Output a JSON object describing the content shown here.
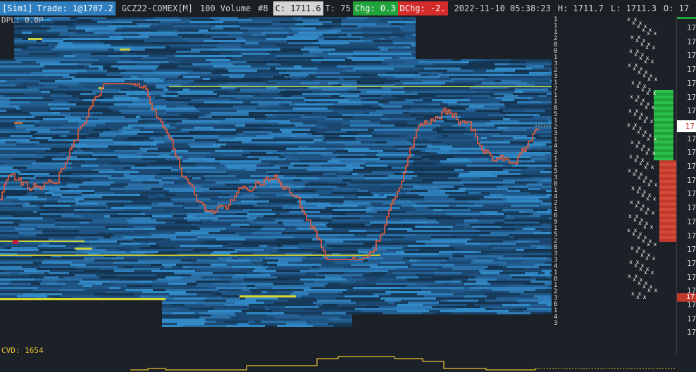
{
  "header": {
    "sim": "[Sim1]",
    "trade": "Trade: 1@1707.2",
    "instrument": "GCZ22-COMEX[M]",
    "volume": "100 Volume",
    "ticks_hash": "#8",
    "close": "C: 1711.6",
    "trades": "T: 75",
    "chg": "Chg: 0.3",
    "dchg": "DChg: -2.",
    "datetime": "2022-11-10 05:38:23",
    "high": "H: 1711.7",
    "low": "L: 1711.3",
    "open": "O: 17"
  },
  "dpl": "DPL: 0.0P",
  "cvd": "CVD: 1654",
  "axis": {
    "labels": [
      "17",
      "17",
      "17",
      "17",
      "17",
      "17",
      "17",
      "17",
      "17",
      "17",
      "17",
      "17",
      "17",
      "17",
      "17",
      "17",
      "17",
      "17",
      "17",
      "17",
      "17",
      "17",
      "17"
    ],
    "current_price": "17",
    "low_marker": "17"
  },
  "vol_strip": [
    "1",
    "1",
    "1",
    "2",
    "8",
    "0",
    "1",
    "3",
    "2",
    "3",
    "1",
    "7",
    "1",
    "1",
    "8",
    "5",
    "1",
    "2",
    "3",
    "1",
    "4",
    "3",
    "1",
    "1",
    "5",
    "3",
    "8",
    "1",
    "4",
    "2",
    "1",
    "6",
    "9",
    "1",
    "5",
    "2",
    "8",
    "3",
    "3",
    "4",
    "1",
    "8",
    "1",
    "2",
    "3",
    "6",
    "1",
    "4",
    "3"
  ],
  "colors": {
    "background": "#1c2127",
    "heat_low": "#163a5a",
    "heat_high": "#2aa0e0",
    "price_line": "#e85c3a",
    "cvd_line": "#e8c233",
    "bid": "#1fa33a",
    "ask": "#d42b2b"
  }
}
